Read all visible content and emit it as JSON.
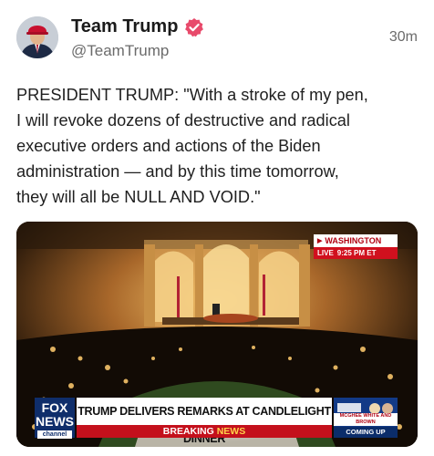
{
  "account": {
    "display_name": "Team Trump",
    "handle": "@TeamTrump",
    "time_ago": "30m"
  },
  "post": {
    "text": "PRESIDENT TRUMP: \"With a stroke of my pen,\nI will revoke dozens of destructive and radical\nexecutive orders and actions of the Biden\nadministration — and by this time tomorrow,\nthey will all be NULL AND VOID.\""
  },
  "video": {
    "location": "WASHINGTON",
    "live": "LIVE",
    "time": "9:25 PM ET",
    "network_logo": "FOX NEWS",
    "network_sub": "channel",
    "headline": "TRUMP DELIVERS REMARKS AT CANDLELIGHT DINNER",
    "breaking_1": "BREAKING",
    "breaking_2": "NEWS",
    "promo_show": "MCGHEE WHITE AND BROWN",
    "promo_status": "COMING UP"
  },
  "colors": {
    "verified": "#e84a6b",
    "fox_blue": "#0f2e6b",
    "breaking_red": "#c4101c"
  }
}
